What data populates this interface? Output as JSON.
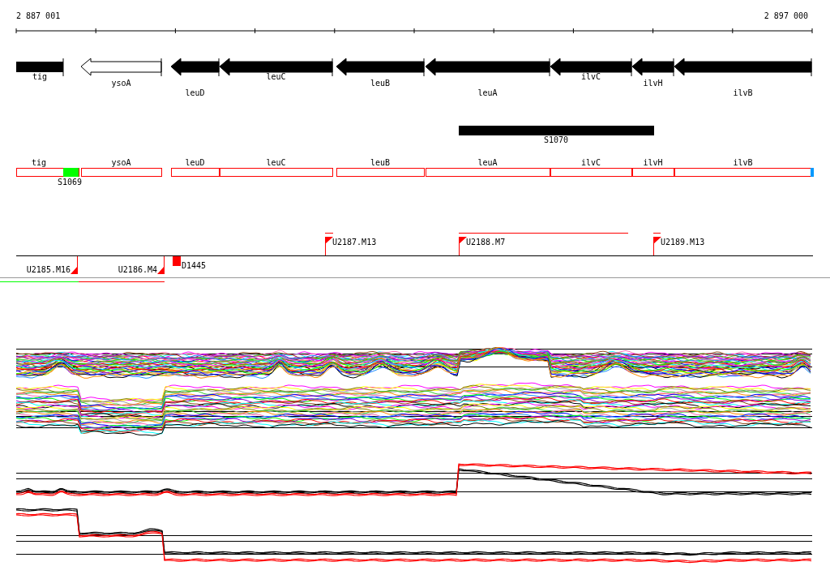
{
  "axis": {
    "start": "2 887 001",
    "end": "2 897 000"
  },
  "genes": [
    {
      "label": "tig",
      "kind": "block"
    },
    {
      "label": "ysoA",
      "kind": "outline-arrow"
    },
    {
      "label": "leuD",
      "kind": "arrow"
    },
    {
      "label": "leuC",
      "kind": "arrow"
    },
    {
      "label": "leuB",
      "kind": "arrow"
    },
    {
      "label": "leuA",
      "kind": "arrow"
    },
    {
      "label": "ilvC",
      "kind": "arrow"
    },
    {
      "label": "ilvH",
      "kind": "arrow"
    },
    {
      "label": "ilvB",
      "kind": "arrow"
    }
  ],
  "segment": {
    "label": "S1070"
  },
  "annotated_genes": [
    "tig",
    "ysoA",
    "leuD",
    "leuC",
    "leuB",
    "leuA",
    "ilvC",
    "ilvH",
    "ilvB"
  ],
  "markers": [
    {
      "label": "S1069",
      "color": "#00ff00"
    }
  ],
  "upper_sites": [
    {
      "label": "U2187.M13",
      "kind": "flag"
    },
    {
      "label": "U2188.M7",
      "kind": "flag"
    },
    {
      "label": "U2189.M13",
      "kind": "flag"
    }
  ],
  "lower_sites": [
    {
      "label": "U2185.M16",
      "kind": "flag"
    },
    {
      "label": "U2186.M4",
      "kind": "flag"
    },
    {
      "label": "D1445",
      "kind": "block"
    }
  ]
}
